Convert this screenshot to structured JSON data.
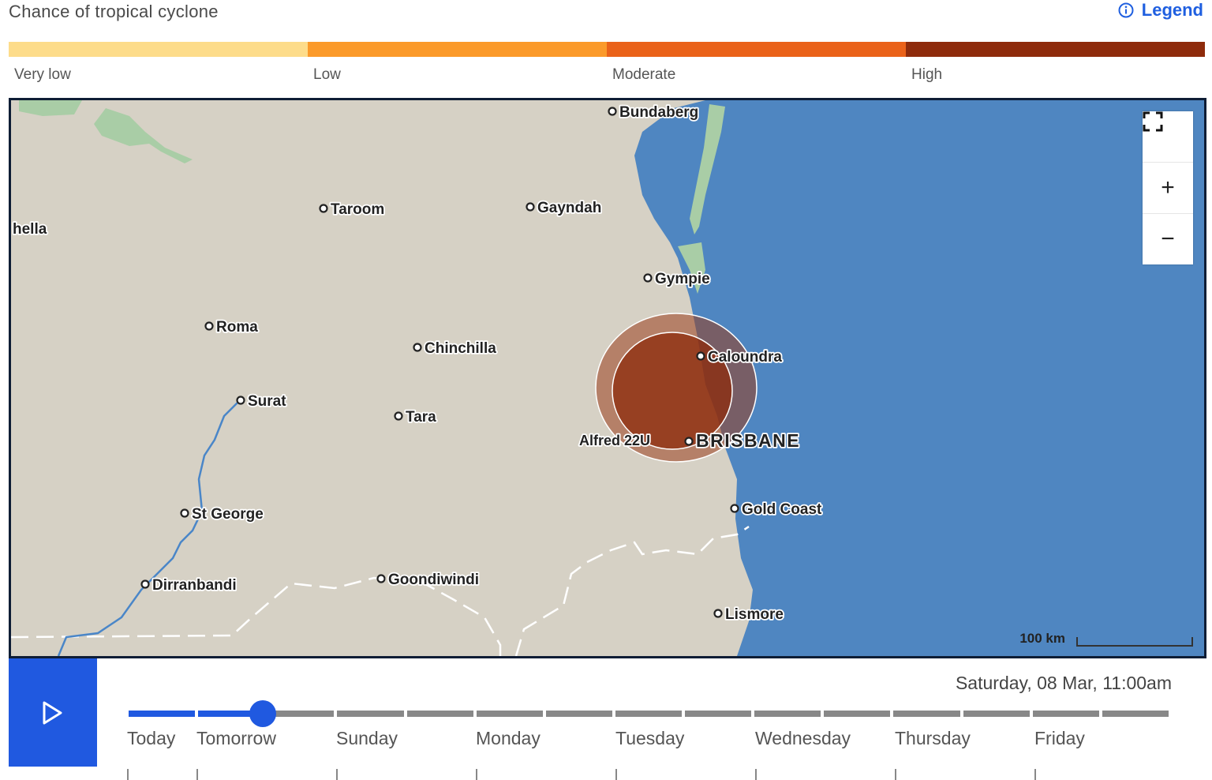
{
  "header": {
    "title": "Chance of tropical cyclone",
    "legend_label": "Legend",
    "info_icon": "info-icon"
  },
  "scale": {
    "levels": [
      {
        "label": "Very low",
        "color": "#fddc8a"
      },
      {
        "label": "Low",
        "color": "#fb9a2a"
      },
      {
        "label": "Moderate",
        "color": "#ea6219"
      },
      {
        "label": "High",
        "color": "#8e2b0b"
      }
    ]
  },
  "map": {
    "colors": {
      "land": "#d6d1c5",
      "ocean": "#4f86c1",
      "park": "#a9cda6"
    },
    "places": [
      {
        "name": "Bundaberg"
      },
      {
        "name": "Taroom"
      },
      {
        "name": "Gayndah"
      },
      {
        "name": "hella"
      },
      {
        "name": "Gympie"
      },
      {
        "name": "Roma"
      },
      {
        "name": "Chinchilla"
      },
      {
        "name": "Caloundra"
      },
      {
        "name": "Surat"
      },
      {
        "name": "Tara"
      },
      {
        "name": "Alfred 22U"
      },
      {
        "name": "BRISBANE"
      },
      {
        "name": "Gold Coast"
      },
      {
        "name": "St George"
      },
      {
        "name": "Goondiwindi"
      },
      {
        "name": "Dirranbandi"
      },
      {
        "name": "Lismore"
      }
    ],
    "controls": {
      "fullscreen": "fullscreen-icon",
      "zoom_in": "+",
      "zoom_out": "−"
    },
    "scale_label": "100 km"
  },
  "timeline": {
    "datetime": "Saturday, 08 Mar, 11:00am",
    "days": [
      "Today",
      "Tomorrow",
      "Sunday",
      "Monday",
      "Tuesday",
      "Wednesday",
      "Thursday",
      "Friday"
    ],
    "play_icon": "play-icon",
    "progress": 0.13
  }
}
